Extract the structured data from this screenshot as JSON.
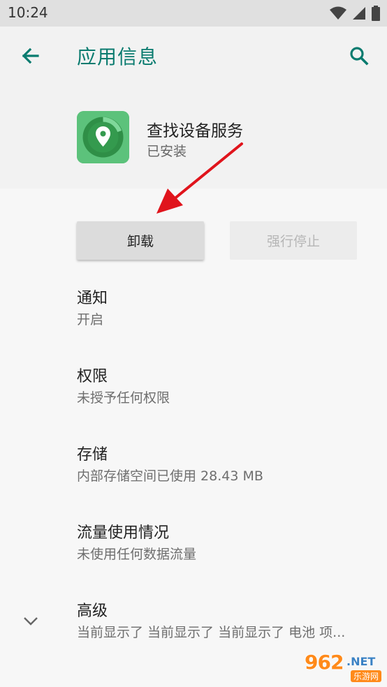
{
  "status_bar": {
    "time": "10:24"
  },
  "app_bar": {
    "title": "应用信息",
    "back_icon": "arrow-back-icon",
    "search_icon": "search-icon"
  },
  "app": {
    "name": "查找设备服务",
    "status": "已安装",
    "icon": "location-pin-icon"
  },
  "buttons": {
    "uninstall": "卸载",
    "force_stop": "强行停止"
  },
  "settings": [
    {
      "title": "通知",
      "summary": "开启"
    },
    {
      "title": "权限",
      "summary": "未授予任何权限"
    },
    {
      "title": "存储",
      "summary": "内部存储空间已使用 28.43 MB"
    },
    {
      "title": "流量使用情况",
      "summary": "未使用任何数据流量"
    },
    {
      "title": "高级",
      "summary": "当前显示了 当前显示了 当前显示了 电池 项..."
    }
  ],
  "colors": {
    "accent": "#0a7b6f",
    "annotation_arrow": "#e0141c"
  },
  "watermark": {
    "number": "962",
    "suffix": ".NET",
    "sub": "乐游网"
  }
}
